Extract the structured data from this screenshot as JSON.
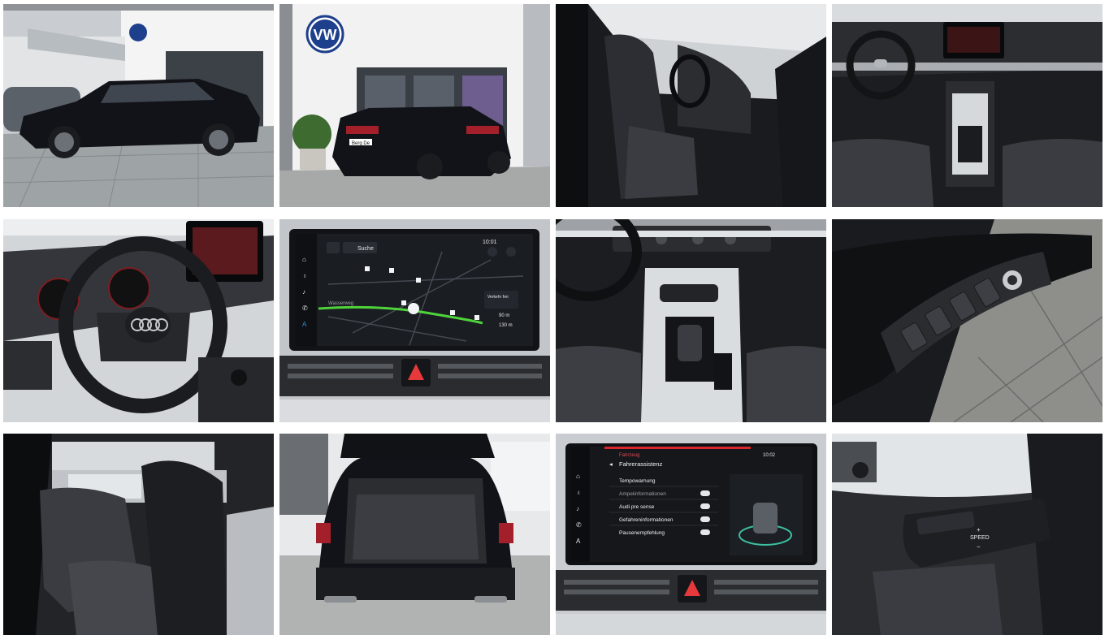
{
  "gallery": {
    "photos": [
      {
        "name": "photo-exterior-front-side"
      },
      {
        "name": "photo-exterior-rear-dealership"
      },
      {
        "name": "photo-interior-front-seats"
      },
      {
        "name": "photo-dashboard-overview"
      },
      {
        "name": "photo-steering-wheel-cockpit"
      },
      {
        "name": "photo-infotainment-map"
      },
      {
        "name": "photo-center-console"
      },
      {
        "name": "photo-door-window-controls"
      },
      {
        "name": "photo-rear-seats"
      },
      {
        "name": "photo-open-trunk"
      },
      {
        "name": "photo-driver-assist-menu"
      },
      {
        "name": "photo-cruise-control-stalk"
      }
    ]
  },
  "car": {
    "plate_text": "Berg De",
    "paint_color": "#121318",
    "brand_blue": "#1e3f8c"
  },
  "map_screen": {
    "search_label": "Suche",
    "time": "10:01",
    "route_label": "Wasserweg",
    "nav_hint": "Verkehr frei",
    "distance_1": "90 m",
    "distance_2": "130 m"
  },
  "assist_screen": {
    "breadcrumb": "Fahrzeug",
    "title": "Fahrerassistenz",
    "time": "10:02",
    "items": [
      {
        "label": "Tempowarnung"
      },
      {
        "label": "Ampelinformationen"
      },
      {
        "label": "Audi pre sense"
      },
      {
        "label": "Gefahreninformationen"
      },
      {
        "label": "Pausenempfehlung"
      }
    ]
  },
  "stalk": {
    "speed_label": "SPEED"
  }
}
